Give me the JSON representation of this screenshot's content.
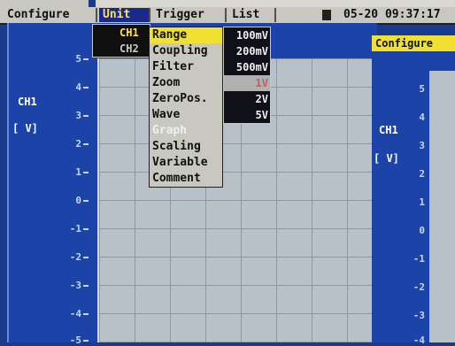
{
  "menubar": {
    "items": [
      "Configure",
      "Unit",
      "Trigger",
      "List"
    ],
    "active_index": 1,
    "datetime": "05-20 09:37:17"
  },
  "left_window": {
    "channel_label": "CH1",
    "unit_label": "[ V]",
    "y_ticks": [
      "5",
      "4",
      "3",
      "2",
      "1",
      "0",
      "-1",
      "-2",
      "-3",
      "-4",
      "-5"
    ]
  },
  "right_window": {
    "title": "Configure",
    "channel_label": "CH1",
    "unit_label": "[ V]",
    "y_ticks": [
      "5",
      "4",
      "3",
      "2",
      "1",
      "0",
      "-1",
      "-2",
      "-3",
      "-4"
    ]
  },
  "channel_menu": {
    "items": [
      "CH1",
      "CH2"
    ],
    "selected_index": 0
  },
  "unit_submenu": {
    "items": [
      "Range",
      "Coupling",
      "Filter",
      "Zoom",
      "ZeroPos.",
      "Wave",
      "Graph",
      "Scaling",
      "Variable",
      "Comment"
    ],
    "selected_index": 0,
    "disabled_index": 6
  },
  "range_menu": {
    "items": [
      "100mV",
      "200mV",
      "500mV",
      "1V",
      "2V",
      "5V"
    ],
    "disabled_index": 3
  }
}
